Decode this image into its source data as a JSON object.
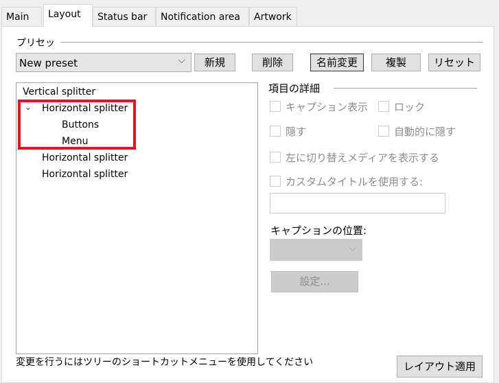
{
  "tabs": [
    {
      "label": "Main"
    },
    {
      "label": "Layout",
      "active": true
    },
    {
      "label": "Status bar"
    },
    {
      "label": "Notification area"
    },
    {
      "label": "Artwork"
    }
  ],
  "preset": {
    "group_label": "プリセッ",
    "selected": "New preset",
    "buttons": {
      "new": "新規",
      "delete": "削除",
      "rename": "名前変更",
      "duplicate": "複製",
      "reset": "リセット"
    }
  },
  "tree": {
    "items": [
      {
        "label": "Vertical splitter",
        "level": 0
      },
      {
        "label": "Horizontal splitter",
        "level": 1,
        "expanded": true
      },
      {
        "label": "Buttons",
        "level": 2
      },
      {
        "label": "Menu",
        "level": 2
      },
      {
        "label": "Horizontal splitter",
        "level": 1
      },
      {
        "label": "Horizontal splitter",
        "level": 1
      }
    ],
    "highlight_color": "#e81123"
  },
  "details": {
    "group_label": "項目の詳細",
    "show_caption": "キャプション表示",
    "lock": "ロック",
    "hide": "隠す",
    "auto_hide": "自動的に隠す",
    "show_toggle_left": "左に切り替えメディアを表示する",
    "custom_title": "カスタムタイトルを使用する:",
    "custom_title_value": "",
    "caption_position_label": "キャプションの位置:",
    "caption_position_value": "",
    "settings_button": "設定..."
  },
  "footer": {
    "hint": "変更を行うにはツリーのショートカットメニューを使用してください",
    "apply_button": "レイアウト適用"
  }
}
